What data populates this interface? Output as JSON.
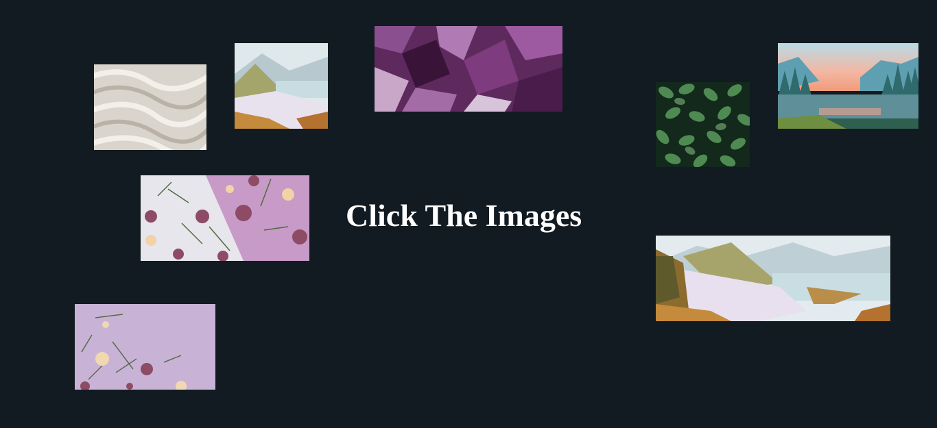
{
  "title": "Click The Images",
  "images": [
    {
      "id": "sand-dunes",
      "alt": "sand dunes"
    },
    {
      "id": "valley-small",
      "alt": "mountain valley painting"
    },
    {
      "id": "amethyst",
      "alt": "amethyst crystals"
    },
    {
      "id": "green-leaves",
      "alt": "green leaves"
    },
    {
      "id": "forest-lake",
      "alt": "forest lake at sunset"
    },
    {
      "id": "flowers-split",
      "alt": "dried flowers on pink and white"
    },
    {
      "id": "valley-wide",
      "alt": "mountain valley painting wide"
    },
    {
      "id": "flowers-lilac",
      "alt": "dried flowers on lilac"
    }
  ]
}
